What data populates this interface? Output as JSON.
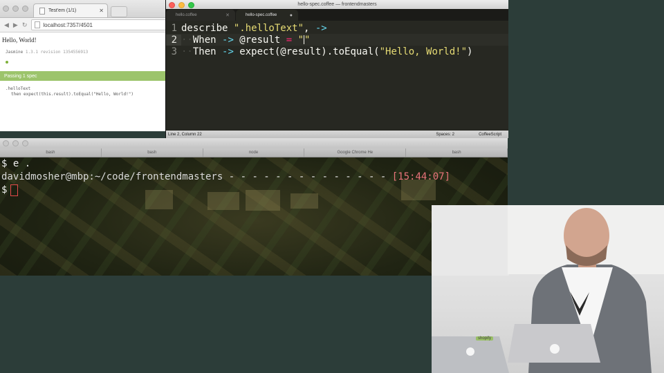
{
  "browser": {
    "tab_title": "Test'em (1/1)",
    "url": "localhost:7357/4501",
    "page": {
      "heading": "Hello, World!",
      "jasmine_name": "Jasmine",
      "jasmine_version": "1.3.1 revision 1354556913",
      "passing_banner": "Passing 1 spec",
      "spec_describe": ".helloText",
      "spec_then": "then expect(this.result).toEqual(\"Hello, World!\")"
    }
  },
  "editor": {
    "window_title": "hello-spec.coffee — frontendmasters",
    "tabs": [
      {
        "label": "hello.coffee"
      },
      {
        "label": "hello-spec.coffee"
      }
    ],
    "lines": [
      {
        "number": "1"
      },
      {
        "number": "2"
      },
      {
        "number": "3"
      }
    ],
    "status": {
      "position": "Line 2, Column 22",
      "spaces": "Spaces: 2",
      "syntax": "CoffeeScript"
    }
  },
  "terminal": {
    "tabs": [
      {
        "label": "bash"
      },
      {
        "label": "bash"
      },
      {
        "label": "node"
      },
      {
        "label": "Google Chrome He"
      },
      {
        "label": "bash"
      }
    ],
    "lines": {
      "command": "$ e .",
      "prompt_path": "davidmosher@mbp:~/code/frontendmasters",
      "dashes": " - - - - - - - - - - - - - - ",
      "time": "[15:44:07]",
      "prompt": "$"
    }
  },
  "webcam": {
    "laptop_sticker": "shopify"
  }
}
